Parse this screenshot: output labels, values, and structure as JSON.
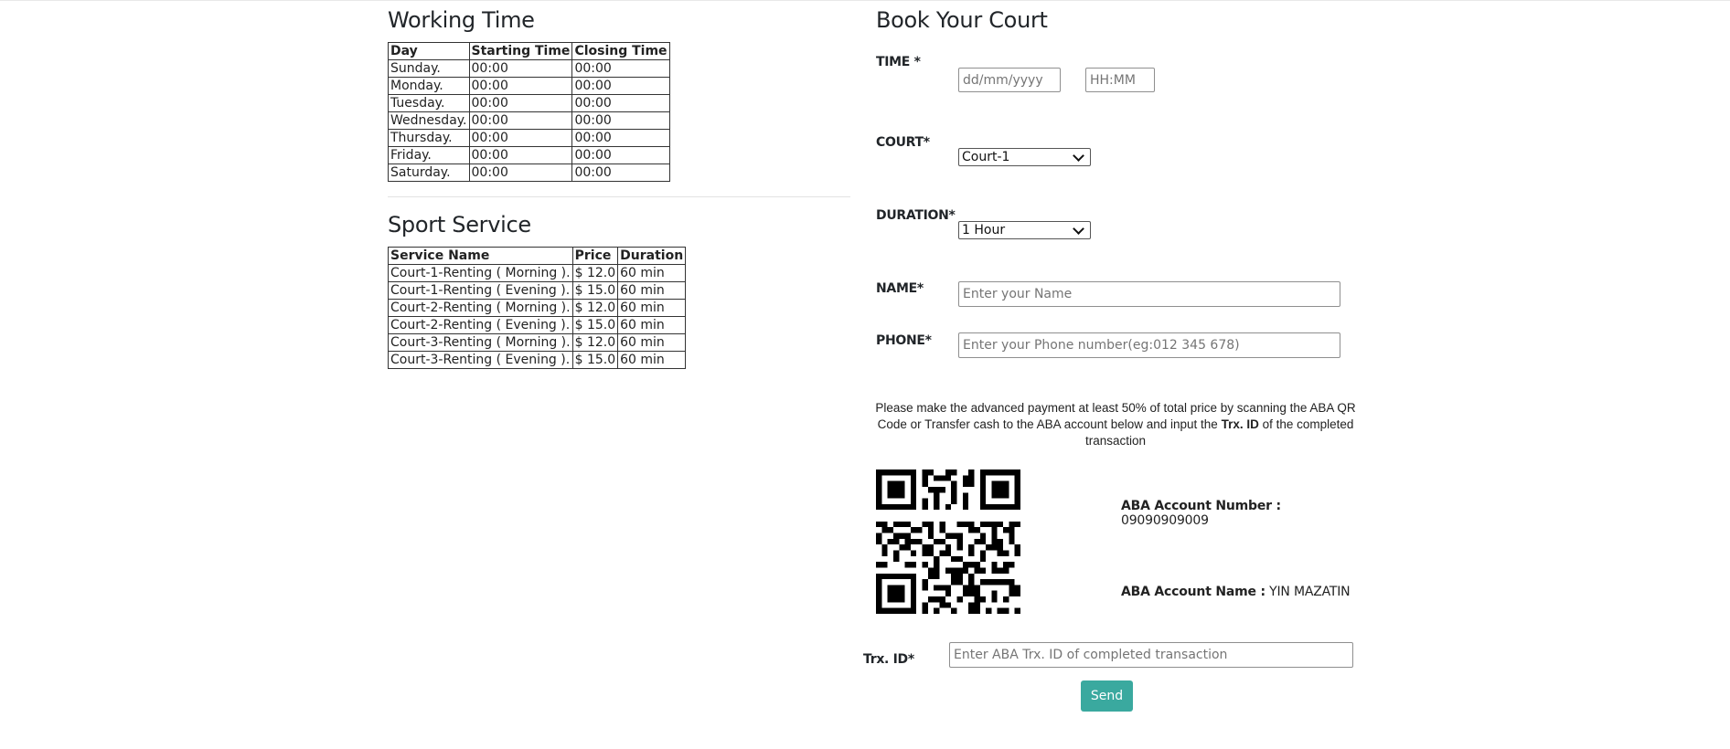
{
  "working_time": {
    "title": "Working Time",
    "headers": [
      "Day",
      "Starting Time",
      "Closing Time"
    ],
    "rows": [
      [
        "Sunday.",
        "00:00",
        "00:00"
      ],
      [
        "Monday.",
        "00:00",
        "00:00"
      ],
      [
        "Tuesday.",
        "00:00",
        "00:00"
      ],
      [
        "Wednesday.",
        "00:00",
        "00:00"
      ],
      [
        "Thursday.",
        "00:00",
        "00:00"
      ],
      [
        "Friday.",
        "00:00",
        "00:00"
      ],
      [
        "Saturday.",
        "00:00",
        "00:00"
      ]
    ]
  },
  "sport_service": {
    "title": "Sport Service",
    "headers": [
      "Service Name",
      "Price",
      "Duration"
    ],
    "rows": [
      [
        "Court-1-Renting ( Morning ).",
        "$ 12.0",
        "60 min"
      ],
      [
        "Court-1-Renting ( Evening ).",
        "$ 15.0",
        "60 min"
      ],
      [
        "Court-2-Renting ( Morning ).",
        "$ 12.0",
        "60 min"
      ],
      [
        "Court-2-Renting ( Evening ).",
        "$ 15.0",
        "60 min"
      ],
      [
        "Court-3-Renting ( Morning ).",
        "$ 12.0",
        "60 min"
      ],
      [
        "Court-3-Renting ( Evening ).",
        "$ 15.0",
        "60 min"
      ]
    ]
  },
  "booking": {
    "title": "Book Your Court",
    "time_label": "TIME *",
    "date_placeholder": "dd/mm/yyyy",
    "time_placeholder": "HH:MM",
    "court_label": "COURT*",
    "court_value": "Court-1",
    "duration_label": "DURATION*",
    "duration_value": "1 Hour",
    "name_label": "NAME*",
    "name_placeholder": "Enter your Name",
    "phone_label": "PHONE*",
    "phone_placeholder": "Enter your Phone number(eg:012 345 678)",
    "notice_pre": "Please make the advanced payment at least 50% of total price by scanning the ABA QR Code or Transfer cash to the ABA account below and input the ",
    "notice_bold": "Trx. ID",
    "notice_post": " of the completed transaction",
    "account_number_label": "ABA Account Number :",
    "account_number": " 09090909009",
    "account_name_label": "ABA Account Name :",
    "account_name": " YIN MAZATIN",
    "trx_label": "Trx. ID*",
    "trx_placeholder": "Enter ABA Trx. ID of completed transaction",
    "send_label": "Send",
    "qr_icon": "qr-code-icon",
    "accent_color": "#3aa99f"
  }
}
